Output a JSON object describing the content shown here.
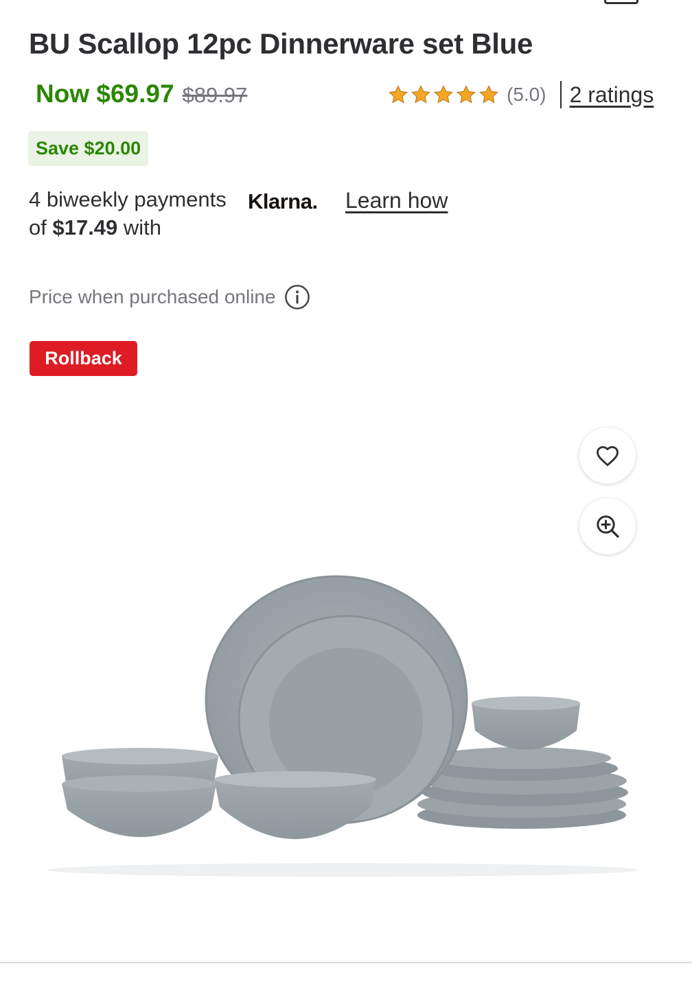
{
  "product": {
    "title": "BU Scallop 12pc Dinnerware set Blue",
    "now_price": "Now $69.97",
    "was_price": "$89.97",
    "save_badge": "Save $20.00",
    "rollback_badge": "Rollback",
    "price_note": "Price when purchased online"
  },
  "rating": {
    "stars": 5,
    "value_text": "(5.0)",
    "count_text": "2 ratings"
  },
  "installments": {
    "prefix": "4 biweekly payments of ",
    "amount": "$17.49",
    "suffix": " with",
    "provider": "Klarna.",
    "learn_link": "Learn how"
  },
  "image_actions": {
    "favorite_icon": "heart-icon",
    "zoom_icon": "zoom-in-icon"
  },
  "colors": {
    "price_green": "#2a8703",
    "rollback_red": "#de1c24",
    "star_gold": "#f5a623",
    "save_bg": "#eaf3e6"
  }
}
